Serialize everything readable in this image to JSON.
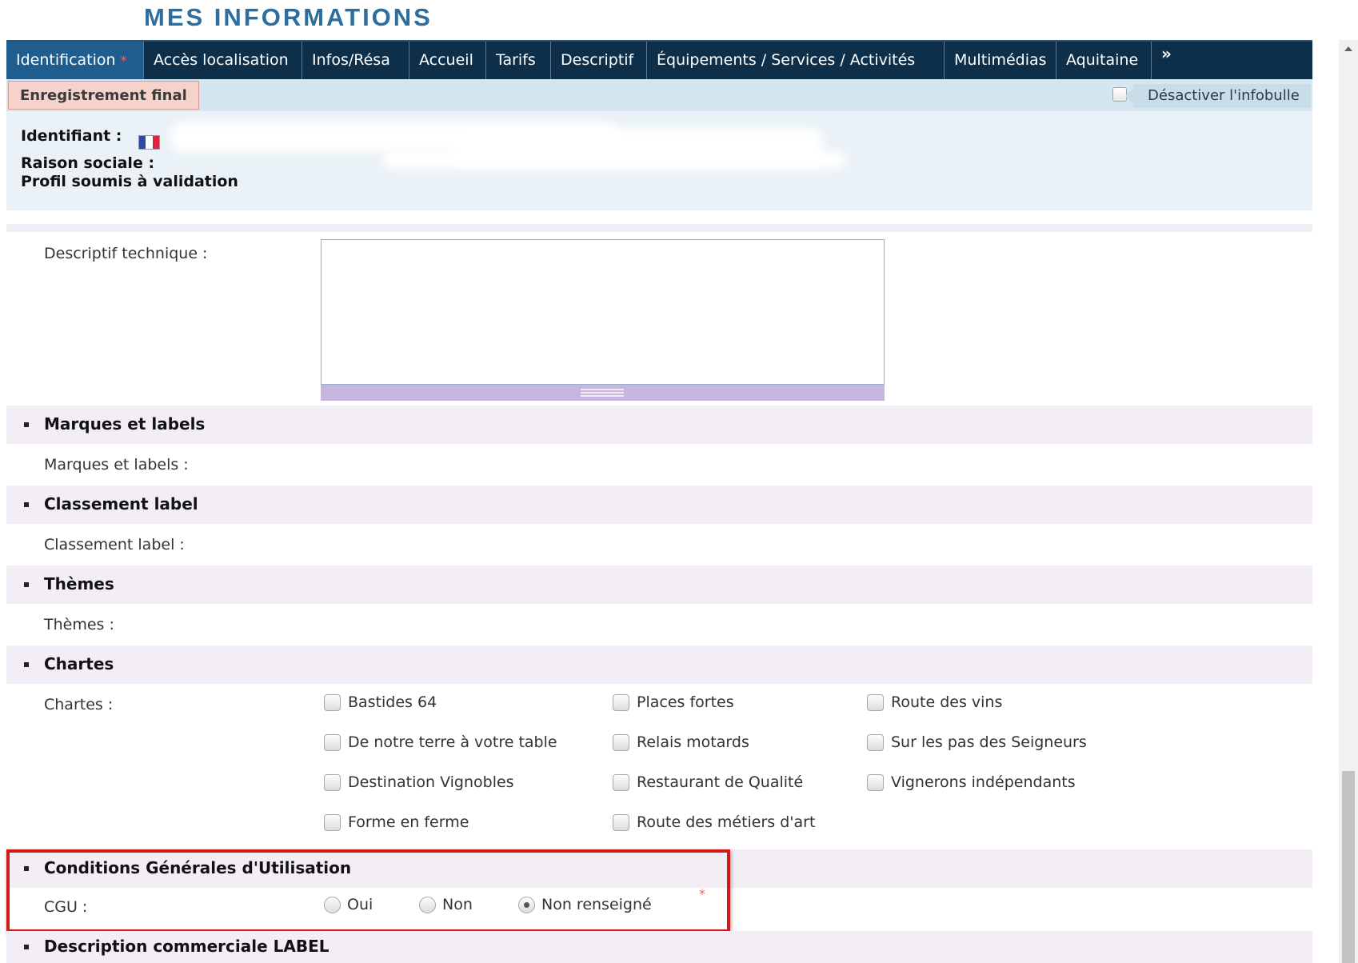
{
  "page": {
    "title": "MES INFORMATIONS"
  },
  "tabs": [
    {
      "label": "Identification",
      "required": "*"
    },
    {
      "label": "Accès localisation"
    },
    {
      "label": "Infos/Résa"
    },
    {
      "label": "Accueil"
    },
    {
      "label": "Tarifs"
    },
    {
      "label": "Descriptif"
    },
    {
      "label": "Équipements / Services / Activités"
    },
    {
      "label": "Multimédias"
    },
    {
      "label": "Aquitaine"
    }
  ],
  "more_tabs": "»",
  "subbar": {
    "final_button": "Enregistrement final",
    "infobulle_label": "Désactiver l'infobulle"
  },
  "identity": {
    "identifiant_label": "Identifiant :",
    "raison_label": "Raison sociale :",
    "profil_label": "Profil soumis à validation"
  },
  "descriptif": {
    "label": "Descriptif technique :",
    "value": ""
  },
  "sections": {
    "marques": {
      "title": "Marques et labels",
      "field": "Marques et labels :"
    },
    "classement": {
      "title": "Classement label",
      "field": "Classement label :"
    },
    "themes": {
      "title": "Thèmes",
      "field": "Thèmes :"
    },
    "chartes": {
      "title": "Chartes",
      "field": "Chartes :",
      "options": [
        "Bastides 64",
        "Places fortes",
        "Route des vins",
        "De notre terre à votre table",
        "Relais motards",
        "Sur les pas des Seigneurs",
        "Destination Vignobles",
        "Restaurant de Qualité",
        "Vignerons indépendants",
        "Forme en ferme",
        "Route des métiers d'art"
      ]
    },
    "cgu": {
      "title": "Conditions Générales d'Utilisation",
      "field": "CGU :",
      "options": [
        "Oui",
        "Non",
        "Non renseigné"
      ],
      "selected": "Non renseigné",
      "required": "*"
    },
    "description_commerciale": {
      "title": "Description commerciale LABEL"
    }
  },
  "colors": {
    "tabbar": "#0d2f4a",
    "active_tab": "#1f5d8e",
    "title": "#2c6e9e",
    "highlight": "#d11a1a"
  }
}
